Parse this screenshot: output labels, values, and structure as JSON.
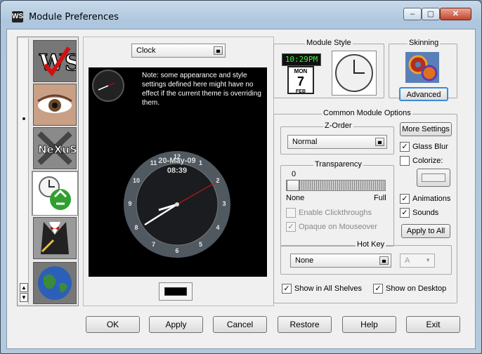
{
  "window": {
    "title": "Module Preferences",
    "icon_text": "WS",
    "controls": {
      "minimize": "–",
      "maximize": "▢",
      "close": "✕"
    }
  },
  "module_dropdown": {
    "value": "Clock"
  },
  "preview": {
    "note": "Note: some appearance and style settings defined here might have no effect if the current theme is overriding them.",
    "clock": {
      "date": "20-May-09",
      "time": "08:39",
      "numerals": [
        "12",
        "1",
        "2",
        "3",
        "4",
        "5",
        "6",
        "7",
        "8",
        "9",
        "10",
        "11"
      ]
    }
  },
  "module_style": {
    "label": "Module Style",
    "digital_time": "10:29PM",
    "calendar_day": "MON",
    "calendar_date": "7",
    "calendar_month": "FEB"
  },
  "skinning": {
    "label": "Skinning",
    "advanced_label": "Advanced"
  },
  "common": {
    "label": "Common Module Options",
    "zorder": {
      "label": "Z-Order",
      "value": "Normal"
    },
    "more_settings": "More Settings",
    "glass_blur": {
      "label": "Glass Blur",
      "checked": true
    },
    "colorize": {
      "label": "Colorize:",
      "checked": false
    },
    "transparency": {
      "label": "Transparency",
      "value": "0",
      "min_label": "None",
      "max_label": "Full",
      "fraction": 0.0
    },
    "enable_clickthroughs": {
      "label": "Enable Clickthroughs",
      "checked": false
    },
    "opaque_on_mouseover": {
      "label": "Opaque on Mouseover",
      "checked": true
    },
    "animations": {
      "label": "Animations",
      "checked": true
    },
    "sounds": {
      "label": "Sounds",
      "checked": true
    },
    "apply_to_all": "Apply to All",
    "hotkey": {
      "label": "Hot Key",
      "value": "None",
      "key": "A"
    },
    "show_in_all_shelves": {
      "label": "Show in All Shelves",
      "checked": true
    },
    "show_on_desktop": {
      "label": "Show on Desktop",
      "checked": true
    }
  },
  "footer": {
    "ok": "OK",
    "apply": "Apply",
    "cancel": "Cancel",
    "restore": "Restore",
    "help": "Help",
    "exit": "Exit"
  },
  "sidebar": {
    "items": [
      {
        "icon": "ws-logo-icon"
      },
      {
        "icon": "eye-icon"
      },
      {
        "icon": "nexus-icon"
      },
      {
        "icon": "clock-recycle-icon"
      },
      {
        "icon": "tuxedo-icon"
      },
      {
        "icon": "globe-icon"
      }
    ]
  }
}
